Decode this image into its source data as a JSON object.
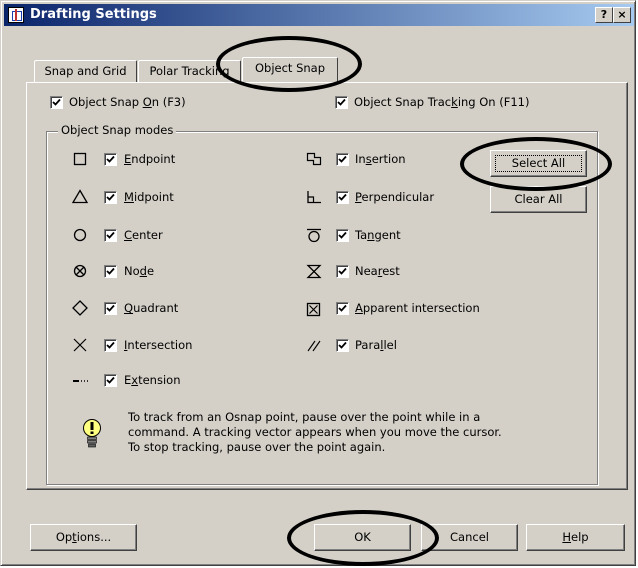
{
  "window": {
    "title": "Drafting Settings",
    "help_button": "?",
    "close_button": "×"
  },
  "tabs": [
    {
      "label": "Snap and Grid"
    },
    {
      "label": "Polar Tracking"
    },
    {
      "label": "Object Snap",
      "active": true
    }
  ],
  "options": {
    "snap_on": {
      "label_pre": "Object Snap ",
      "label_u": "O",
      "label_post": "n (F3)",
      "checked": true
    },
    "tracking_on": {
      "label_pre": "Object Snap Trac",
      "label_u": "k",
      "label_post": "ing On (F11)",
      "checked": true
    }
  },
  "modes_group_label": "Object Snap modes",
  "modes_left": [
    {
      "pre": "",
      "u": "E",
      "post": "ndpoint",
      "symbol": "square-icon",
      "checked": true
    },
    {
      "pre": "",
      "u": "M",
      "post": "idpoint",
      "symbol": "triangle-icon",
      "checked": true
    },
    {
      "pre": "",
      "u": "C",
      "post": "enter",
      "symbol": "circle-icon",
      "checked": true
    },
    {
      "pre": "No",
      "u": "d",
      "post": "e",
      "symbol": "node-icon",
      "checked": true
    },
    {
      "pre": "",
      "u": "Q",
      "post": "uadrant",
      "symbol": "diamond-icon",
      "checked": true
    },
    {
      "pre": "",
      "u": "I",
      "post": "ntersection",
      "symbol": "x-icon",
      "checked": true
    },
    {
      "pre": "E",
      "u": "x",
      "post": "tension",
      "symbol": "extension-icon",
      "checked": true
    }
  ],
  "modes_right": [
    {
      "pre": "In",
      "u": "s",
      "post": "ertion",
      "symbol": "insertion-icon",
      "checked": true
    },
    {
      "pre": "",
      "u": "P",
      "post": "erpendicular",
      "symbol": "perpendicular-icon",
      "checked": true
    },
    {
      "pre": "Ta",
      "u": "n",
      "post": "gent",
      "symbol": "tangent-icon",
      "checked": true
    },
    {
      "pre": "Nea",
      "u": "r",
      "post": "est",
      "symbol": "nearest-icon",
      "checked": true
    },
    {
      "pre": "",
      "u": "A",
      "post": "pparent intersection",
      "symbol": "apparent-intersection-icon",
      "checked": true
    },
    {
      "pre": "Para",
      "u": "l",
      "post": "lel",
      "symbol": "parallel-icon",
      "checked": true
    }
  ],
  "buttons": {
    "select_all": "Select All",
    "clear_all": "Clear All",
    "options_pre": "Op",
    "options_u": "t",
    "options_post": "ions...",
    "ok": "OK",
    "cancel": "Cancel",
    "help_u": "H",
    "help_post": "elp"
  },
  "tip": {
    "icon": "lightbulb-icon",
    "line1": "To track from an Osnap point, pause over the point while in a",
    "line2": "command.  A tracking vector appears when you move the cursor.",
    "line3": "To stop tracking, pause over the point again."
  },
  "annotations": {
    "highlight_color": "#000000",
    "highlighted": [
      "Object Snap",
      "Select All",
      "OK"
    ]
  }
}
